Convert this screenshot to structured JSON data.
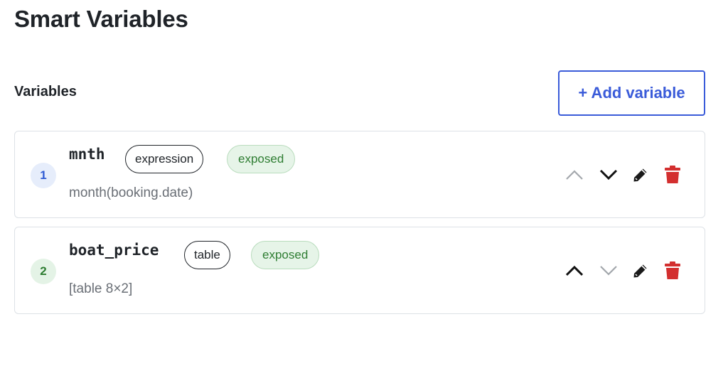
{
  "page": {
    "title": "Smart Variables"
  },
  "section": {
    "label": "Variables",
    "add_button": "+ Add variable"
  },
  "colors": {
    "accent": "#3a5bd9",
    "exposed_bg": "#e6f4e8",
    "exposed_text": "#2e7d32",
    "delete": "#d32f2f"
  },
  "variables": [
    {
      "index": "1",
      "name": "mnth",
      "type": "expression",
      "status": "exposed",
      "description": "month(booking.date)",
      "move_up_enabled": false,
      "move_down_enabled": true,
      "icons": [
        "chevron-up-icon",
        "chevron-down-icon",
        "pencil-icon",
        "trash-icon"
      ]
    },
    {
      "index": "2",
      "name": "boat_price",
      "type": "table",
      "status": "exposed",
      "description": "[table 8×2]",
      "move_up_enabled": true,
      "move_down_enabled": false,
      "icons": [
        "chevron-up-icon",
        "chevron-down-icon",
        "pencil-icon",
        "trash-icon"
      ]
    }
  ]
}
